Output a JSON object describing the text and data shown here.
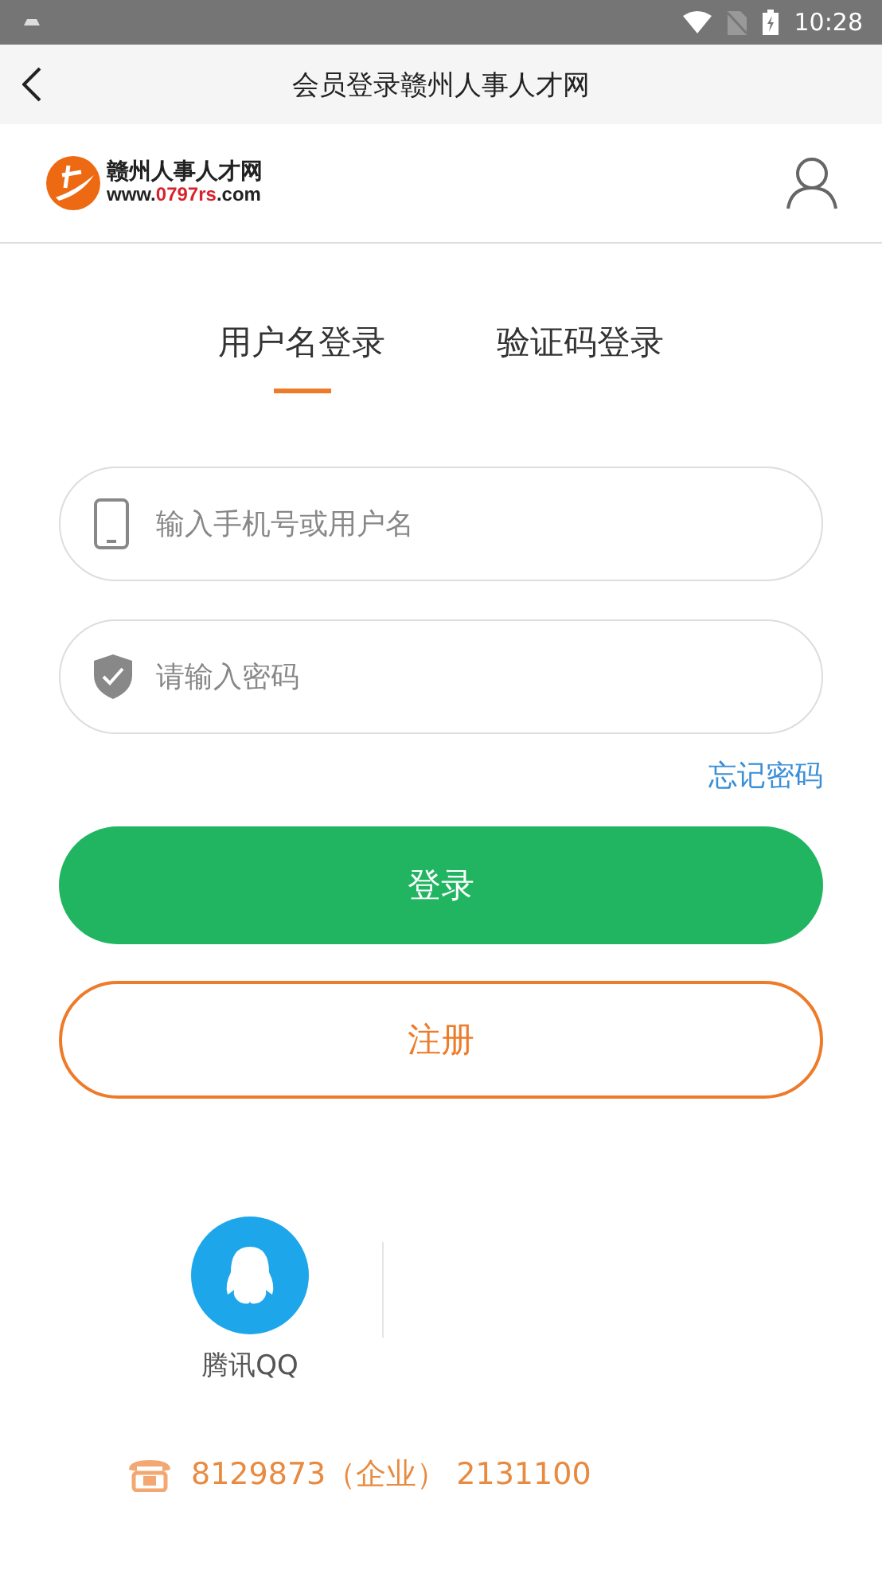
{
  "status_bar": {
    "time": "10:28"
  },
  "nav": {
    "title": "会员登录赣州人事人才网"
  },
  "logo": {
    "name": "赣州人事人才网",
    "url": [
      {
        "text": "www.",
        "highlight": false
      },
      {
        "text": "0797rs",
        "highlight": true
      },
      {
        "text": ".com",
        "highlight": false
      }
    ]
  },
  "tabs": [
    {
      "label": "用户名登录",
      "selected": true
    },
    {
      "label": "验证码登录",
      "selected": false
    }
  ],
  "fields": [
    {
      "kind": "phone",
      "placeholder": "输入手机号或用户名"
    },
    {
      "kind": "password",
      "placeholder": "请输入密码"
    }
  ],
  "forgot_link": "忘记密码",
  "login_button": "登录",
  "register_button": "注册",
  "social": [
    {
      "label": "腾讯QQ"
    }
  ],
  "contact": "8129873（企业） 2131100"
}
